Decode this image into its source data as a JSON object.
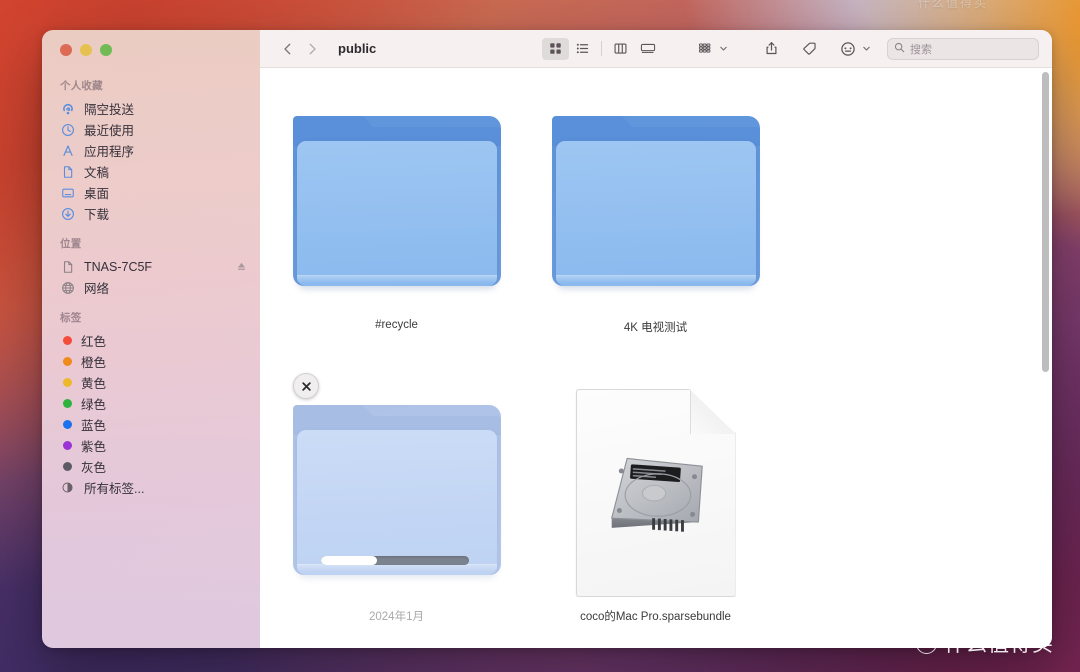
{
  "watermark": {
    "top_text": "什么值得买",
    "badge": "值",
    "bottom_text": "什么值得买"
  },
  "window": {
    "traffic_lights": [
      {
        "name": "close",
        "color": "#dd6a55"
      },
      {
        "name": "minimize",
        "color": "#e5c14f"
      },
      {
        "name": "zoom",
        "color": "#70bb54"
      }
    ]
  },
  "sidebar": {
    "sections": [
      {
        "title": "个人收藏",
        "items": [
          {
            "label": "隔空投送",
            "icon": "airdrop-icon"
          },
          {
            "label": "最近使用",
            "icon": "clock-icon"
          },
          {
            "label": "应用程序",
            "icon": "applications-icon"
          },
          {
            "label": "文稿",
            "icon": "document-icon"
          },
          {
            "label": "桌面",
            "icon": "desktop-icon"
          },
          {
            "label": "下载",
            "icon": "downloads-icon"
          }
        ]
      },
      {
        "title": "位置",
        "items": [
          {
            "label": "TNAS-7C5F",
            "icon": "server-icon",
            "eject": true
          },
          {
            "label": "网络",
            "icon": "network-globe-icon"
          }
        ]
      },
      {
        "title": "标签",
        "items": [
          {
            "label": "红色",
            "icon": "tag-dot-icon",
            "color": "#f54b3b"
          },
          {
            "label": "橙色",
            "icon": "tag-dot-icon",
            "color": "#ef8a1b"
          },
          {
            "label": "黄色",
            "icon": "tag-dot-icon",
            "color": "#edb92b"
          },
          {
            "label": "绿色",
            "icon": "tag-dot-icon",
            "color": "#2eb33f"
          },
          {
            "label": "蓝色",
            "icon": "tag-dot-icon",
            "color": "#1b72ee"
          },
          {
            "label": "紫色",
            "icon": "tag-dot-icon",
            "color": "#9b33d6"
          },
          {
            "label": "灰色",
            "icon": "tag-dot-icon",
            "color": "#5d5a66"
          },
          {
            "label": "所有标签...",
            "icon": "all-tags-icon"
          }
        ]
      }
    ]
  },
  "toolbar": {
    "back_label": "‹",
    "forward_label": "›",
    "breadcrumb": "public",
    "view_buttons": [
      {
        "name": "icon-view",
        "selected": true
      },
      {
        "name": "list-view",
        "selected": false
      },
      {
        "name": "column-view",
        "selected": false
      },
      {
        "name": "gallery-view",
        "selected": false
      }
    ],
    "action_buttons": [
      {
        "name": "group-by"
      },
      {
        "name": "share"
      },
      {
        "name": "tag"
      },
      {
        "name": "more-actions"
      }
    ]
  },
  "search": {
    "placeholder": "搜索",
    "value": ""
  },
  "files": [
    {
      "name": "#recycle",
      "kind": "folder",
      "state": "normal"
    },
    {
      "name": "4K 电视测试",
      "kind": "folder",
      "state": "normal"
    },
    {
      "name": "2024年1月",
      "kind": "folder",
      "state": "copying",
      "progress_percent": 38,
      "cancel_badge": "✕"
    },
    {
      "name": "coco的Mac Pro.sparsebundle",
      "kind": "disk-image",
      "state": "normal"
    }
  ]
}
